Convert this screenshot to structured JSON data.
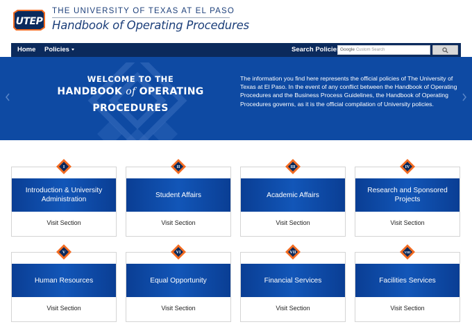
{
  "header": {
    "logo_text": "UTEP",
    "university": "THE UNIVERSITY OF TEXAS AT EL PASO",
    "site_title": "Handbook of Operating Procedures"
  },
  "nav": {
    "home": "Home",
    "policies": "Policies",
    "search_label": "Search Policies:",
    "search_brand": "Google",
    "search_placeholder": "Custom Search"
  },
  "hero": {
    "title_line1": "WELCOME TO THE",
    "title_line2_a": "HANDBOOK",
    "title_line2_of": "of",
    "title_line2_b": "OPERATING",
    "title_line3": "PROCEDURES",
    "text": "The information you find here represents the official policies of The University of Texas at El Paso. In the event of any conflict between the Handbook of Operating Procedures and the Business Process Guidelines, the Handbook of Operating Procedures governs, as it is the official compilation of University policies."
  },
  "sections": [
    {
      "numeral": "I",
      "title": "Introduction & University Administration",
      "link": "Visit Section"
    },
    {
      "numeral": "II",
      "title": "Student Affairs",
      "link": "Visit Section"
    },
    {
      "numeral": "III",
      "title": "Academic Affairs",
      "link": "Visit Section"
    },
    {
      "numeral": "IV",
      "title": "Research and Sponsored Projects",
      "link": "Visit Section"
    },
    {
      "numeral": "V",
      "title": "Human Resources",
      "link": "Visit Section"
    },
    {
      "numeral": "VI",
      "title": "Equal Opportunity",
      "link": "Visit Section"
    },
    {
      "numeral": "VII",
      "title": "Financial Services",
      "link": "Visit Section"
    },
    {
      "numeral": "VIII",
      "title": "Facilities Services",
      "link": "Visit Section"
    }
  ],
  "colors": {
    "navy": "#0b2a5c",
    "hero_blue": "#0e4aa3",
    "orange": "#f26b21"
  }
}
